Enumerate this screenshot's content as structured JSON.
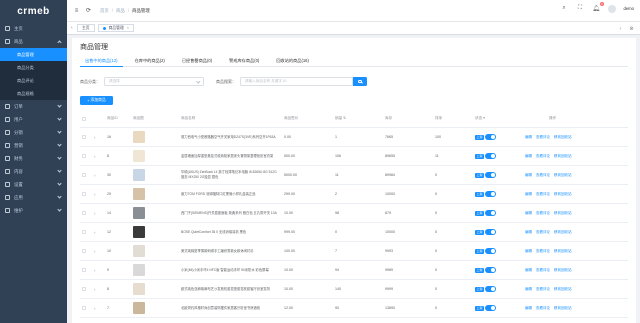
{
  "app": {
    "logo": "crmeb"
  },
  "sidebar": {
    "items": [
      {
        "label": "主页",
        "icon": "home-icon"
      },
      {
        "label": "商品",
        "icon": "goods-icon",
        "open": true,
        "children": [
          {
            "label": "商品管理",
            "active": true
          },
          {
            "label": "商品分类"
          },
          {
            "label": "商品评论"
          },
          {
            "label": "商品规格"
          }
        ]
      },
      {
        "label": "订单",
        "icon": "order-icon"
      },
      {
        "label": "用户",
        "icon": "user-icon"
      },
      {
        "label": "分销",
        "icon": "distribution-icon"
      },
      {
        "label": "营销",
        "icon": "marketing-icon"
      },
      {
        "label": "财务",
        "icon": "finance-icon"
      },
      {
        "label": "内容",
        "icon": "content-icon"
      },
      {
        "label": "设置",
        "icon": "settings-icon"
      },
      {
        "label": "应用",
        "icon": "app-icon"
      },
      {
        "label": "维护",
        "icon": "maintain-icon"
      }
    ]
  },
  "navbar": {
    "breadcrumb": [
      "首页",
      "商品",
      "商品管理"
    ],
    "notification_count": "4",
    "user": "demo"
  },
  "tags": [
    {
      "label": "主页"
    },
    {
      "label": "商品管理",
      "active": true
    }
  ],
  "page": {
    "title": "商品管理",
    "tabs": [
      {
        "label": "出售中的商品(12)",
        "active": true
      },
      {
        "label": "仓库中的商品(2)"
      },
      {
        "label": "已经售罄商品(0)"
      },
      {
        "label": "警戒库存商品(0)"
      },
      {
        "label": "回收站的商品(16)"
      }
    ],
    "filter": {
      "category_label": "商品分类：",
      "category_placeholder": "请选择",
      "search_label": "商品搜索：",
      "search_placeholder": "请输入商品名称,关键字,ID"
    },
    "add_button": "添加商品"
  },
  "table": {
    "headers": [
      "商品ID",
      "商品图",
      "商品名称",
      "商品售价",
      "销量",
      "库存",
      "排序",
      "状态",
      "操作"
    ],
    "ops": [
      "编辑",
      "查看评论",
      "移到回收站"
    ],
    "status_label": "上架",
    "rows": [
      {
        "id": "16",
        "name": "德力西电气小型断路器空气开关家用DZ47S(3VE)系列空开1P63A",
        "price": "0.00",
        "sales": "1",
        "stock": "7665",
        "sort": "100",
        "thumb_color": "#e8d9c0"
      },
      {
        "id": "8",
        "name": "金属墙面加厚重型悬挂式收纳柜家居床头置物架整理柜卧室衣架",
        "price": "500.00",
        "sales": "106",
        "stock": "89655",
        "sort": "11",
        "thumb_color": "#efe6d6"
      },
      {
        "id": "30",
        "name": "华硕(ASUS) ZenBook 14 英寸轻薄笔记本电脑 i5-8265U 8G 512G固态 MX250 2G独显 银色",
        "price": "5000.00",
        "sales": "11",
        "stock": "89984",
        "sort": "0",
        "thumb_color": "#c8d6e6"
      },
      {
        "id": "29",
        "name": "魔力TOM FORD 汤姆福特口红黑管小样礼盒装正品",
        "price": "299.00",
        "sales": "2",
        "stock": "10000",
        "sort": "0",
        "thumb_color": "#d6c2a8"
      },
      {
        "id": "14",
        "name": "西门子(SIEMENS)开关插座面板 致典系列 雅白色 五孔带开关 10A",
        "price": "10.00",
        "sales": "98",
        "stock": "879",
        "sort": "0",
        "thumb_color": "#8a8f96"
      },
      {
        "id": "12",
        "name": "BOSE QuietComfort 35 II 无线消噪耳机 黑色",
        "price": "999.00",
        "sales": "0",
        "stock": "10000",
        "sort": "0",
        "thumb_color": "#3a3a3a"
      },
      {
        "id": "10",
        "name": "美式纯棉夏季薄款刺绣手工编织男款女款休闲衬衫",
        "price": "100.00",
        "sales": "7",
        "stock": "9993",
        "sort": "0",
        "thumb_color": "#e2ddd4"
      },
      {
        "id": "9",
        "name": "小米(MI)小米手环4 NFC版 智能运动手环 50米防水 彩色屏幕",
        "price": "10.00",
        "sales": "94",
        "stock": "9989",
        "sort": "0",
        "thumb_color": "#d9d9d9"
      },
      {
        "id": "8",
        "name": "欧式纯色亚麻棉麻布艺沙发抱枕套靠垫套靠枕套客厅卧室靠背",
        "price": "10.00",
        "sales": "140",
        "stock": "9999",
        "sort": "0",
        "thumb_color": "#e6dcd0"
      },
      {
        "id": "7",
        "name": "北欧简约风格时尚创意装饰摆件家居客厅卧室书房酒柜",
        "price": "12.00",
        "sales": "90",
        "stock": "13890",
        "sort": "0",
        "thumb_color": "#cbb79b"
      }
    ]
  }
}
